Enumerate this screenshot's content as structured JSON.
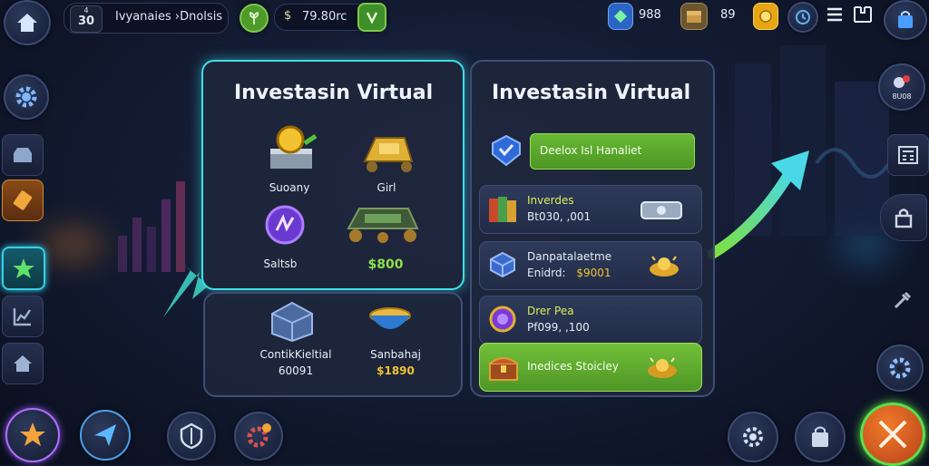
{
  "topbar": {
    "level": "30",
    "level_badge": "4",
    "player_name": "Ivyanaies ›Dnolsis",
    "currency": "79.80rc",
    "counter_1": "988",
    "counter_2": "89"
  },
  "left_panel": {
    "title": "Investasin Virtual",
    "items": [
      {
        "label": "Suoany",
        "value": ""
      },
      {
        "label": "Girl",
        "value": ""
      },
      {
        "label": "Saltsb",
        "value": ""
      },
      {
        "label": "",
        "value": "$800"
      },
      {
        "label": "ContikKieltial",
        "value": "60091"
      },
      {
        "label": "Sanbahaj",
        "value": "$1890"
      }
    ]
  },
  "right_panel": {
    "title": "Investasin Virtual",
    "header_button": "Deelox Isl Hanaliet",
    "rows": [
      {
        "name": "Inverdes",
        "detail": "Bt030, ,001"
      },
      {
        "name": "Danpatalaetme",
        "detail": "Enidrd:",
        "value": "$9001"
      },
      {
        "name": "Drer Pea",
        "detail": "Pf099, ,100"
      },
      {
        "name": "Inedices Stoicley",
        "detail": ""
      }
    ]
  },
  "right_sidebar": {
    "badge_label": "8U08"
  },
  "colors": {
    "accent_green": "#6cc43a",
    "accent_cyan": "#45d7e4",
    "gold": "#f2c230",
    "panel_bg": "#1e263c"
  }
}
